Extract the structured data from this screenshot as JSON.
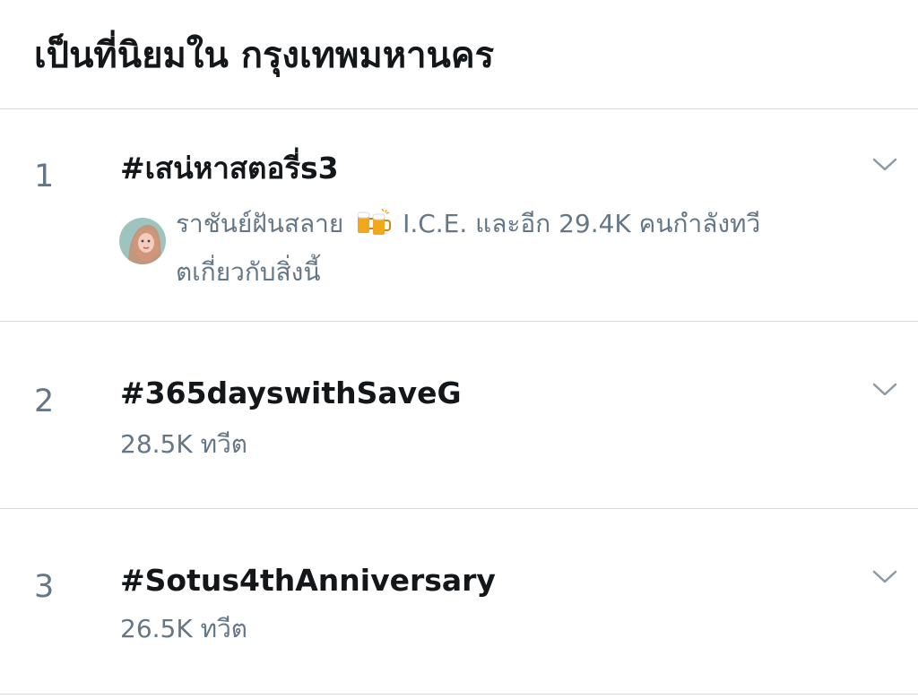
{
  "header": {
    "title": "เป็นที่นิยมใน กรุงเทพมหานคร"
  },
  "trends": [
    {
      "rank": "1",
      "hashtag": "#เสน่หาสตอรี่s3",
      "context": {
        "user1": "ราชันย์ฝันสลาย",
        "icon": "beer-mugs-icon",
        "user2_and_more": "I.C.E. และอีก 29.4K คนกำลังทวี",
        "line2": "ตเกี่ยวกับสิ่งนี้"
      }
    },
    {
      "rank": "2",
      "hashtag": "#365dayswithSaveG",
      "count": "28.5K ทวีต"
    },
    {
      "rank": "3",
      "hashtag": "#Sotus4thAnniversary",
      "count": "26.5K ทวีต"
    }
  ],
  "colors": {
    "primary_text": "#14171a",
    "secondary_text": "#657786",
    "divider": "#d6dbe0",
    "background": "#ffffff"
  }
}
